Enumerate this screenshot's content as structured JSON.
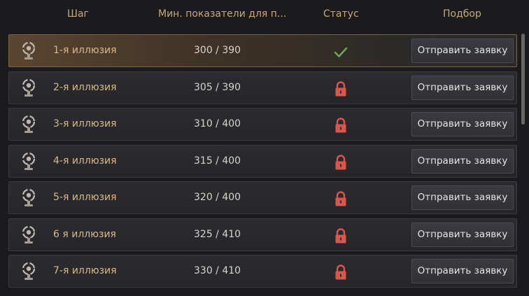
{
  "header": {
    "step": "Шаг",
    "min": "Мин. показатели для п...",
    "status": "Статус",
    "select": "Подбор"
  },
  "rows": [
    {
      "name": "1-я иллюзия",
      "value": "300 / 390",
      "status": "check",
      "button": "Отправить заявку"
    },
    {
      "name": "2-я иллюзия",
      "value": "305 / 390",
      "status": "lock",
      "button": "Отправить заявку"
    },
    {
      "name": "3-я иллюзия",
      "value": "310 / 400",
      "status": "lock",
      "button": "Отправить заявку"
    },
    {
      "name": "4-я иллюзия",
      "value": "315 / 400",
      "status": "lock",
      "button": "Отправить заявку"
    },
    {
      "name": "5-я иллюзия",
      "value": "320 / 400",
      "status": "lock",
      "button": "Отправить заявку"
    },
    {
      "name": "6 я иллюзия",
      "value": "325 / 410",
      "status": "lock",
      "button": "Отправить заявку"
    },
    {
      "name": "7-я иллюзия",
      "value": "330 / 410",
      "status": "lock",
      "button": "Отправить заявку"
    }
  ],
  "colors": {
    "accent": "#c9a97a",
    "check": "#6aa84f",
    "lock": "#d9564a"
  },
  "icons": {
    "row": "illusion-emblem-icon",
    "done": "checkmark-icon",
    "locked": "lock-icon"
  }
}
